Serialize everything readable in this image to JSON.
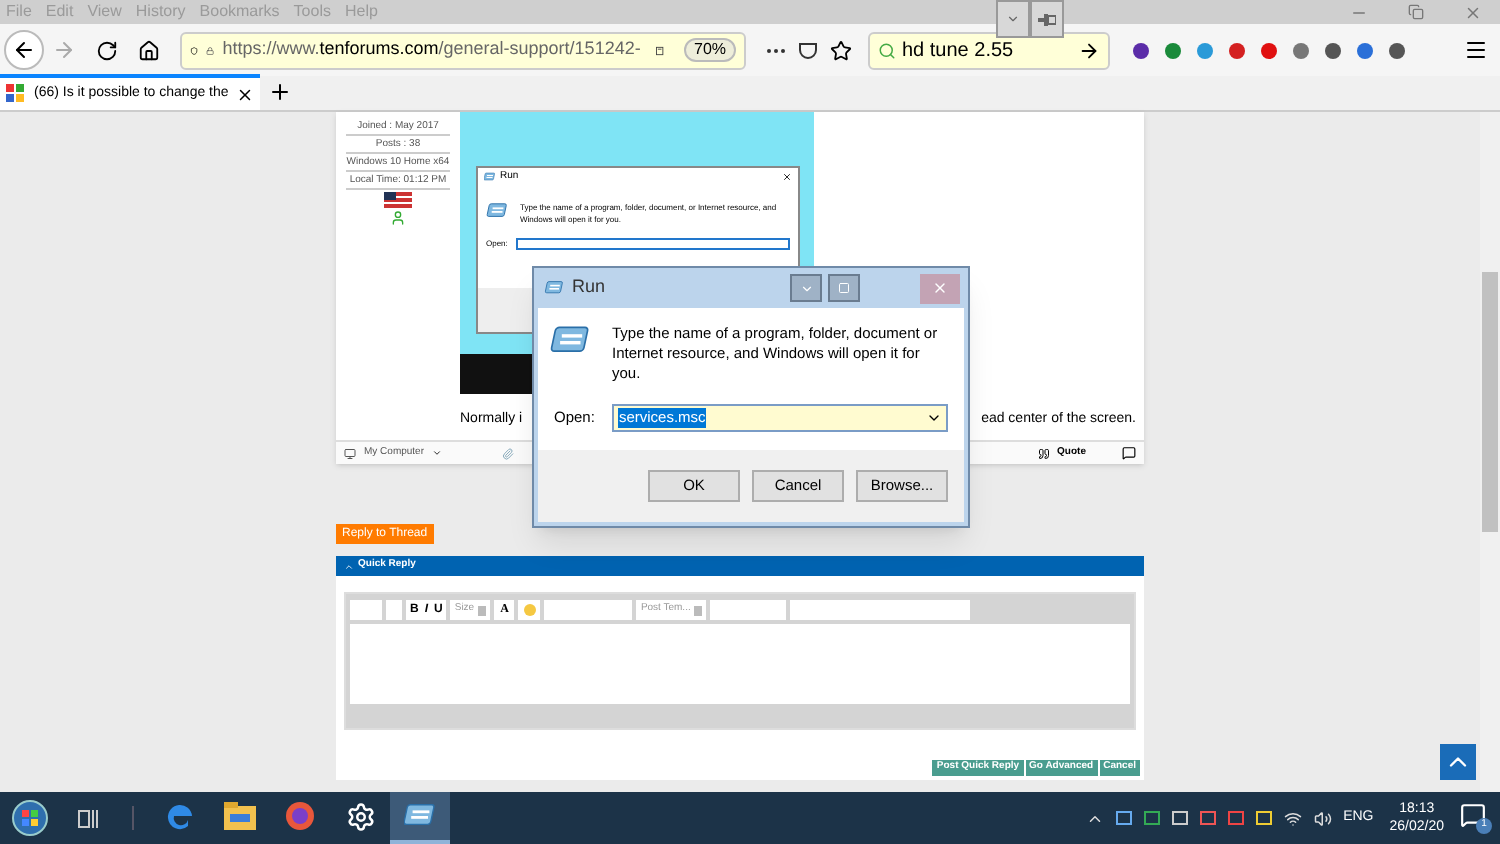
{
  "menu_bar": {
    "items": [
      "File",
      "Edit",
      "View",
      "History",
      "Bookmarks",
      "Tools",
      "Help"
    ]
  },
  "address_bar": {
    "url": {
      "prefix": "https://www.",
      "domain": "tenforums.com",
      "path": "/general-support/151242-"
    },
    "zoom": "70%"
  },
  "search": {
    "value": "hd tune 2.55"
  },
  "tabs": [
    {
      "title": "(66) Is it possible to change the",
      "selected": true
    }
  ],
  "post": {
    "user_info": [
      "Joined : May 2017",
      "Posts : 38",
      "Windows 10 Home x64",
      "Local Time: 01:12 PM"
    ],
    "image": {
      "dialog_title": "Run",
      "dialog_text": "Type the name of a program, folder, document, or Internet resource, and Windows will open it for you.",
      "open_label": "Open:"
    },
    "text_left": "Normally i",
    "text_right": "ead center of the screen.",
    "footer": {
      "my_computer": "My Computer",
      "quote": "Quote"
    }
  },
  "reply_button": "Reply to Thread",
  "quick_reply": {
    "title": "Quick Reply",
    "format_buttons": [
      "B",
      "I",
      "U"
    ],
    "size_select": "Size",
    "font_button": "A",
    "template_select": "Post Tem...",
    "buttons": [
      "Post Quick Reply",
      "Go Advanced",
      "Cancel"
    ]
  },
  "run_dialog": {
    "title": "Run",
    "message": "Type the name of a program, folder, document or Internet resource, and Windows will open it for you.",
    "open_label": "Open:",
    "value": "services.msc",
    "buttons": [
      "OK",
      "Cancel",
      "Browse..."
    ]
  },
  "taskbar": {
    "apps": [
      {
        "kind": "edge",
        "selected": false
      },
      {
        "kind": "explorer",
        "selected": false
      },
      {
        "kind": "firefox",
        "selected": false
      },
      {
        "kind": "settings",
        "selected": false
      },
      {
        "kind": "run",
        "selected": true
      }
    ],
    "language": "ENG",
    "time": "18:13",
    "date": "26/02/20",
    "notification_count": "1"
  }
}
